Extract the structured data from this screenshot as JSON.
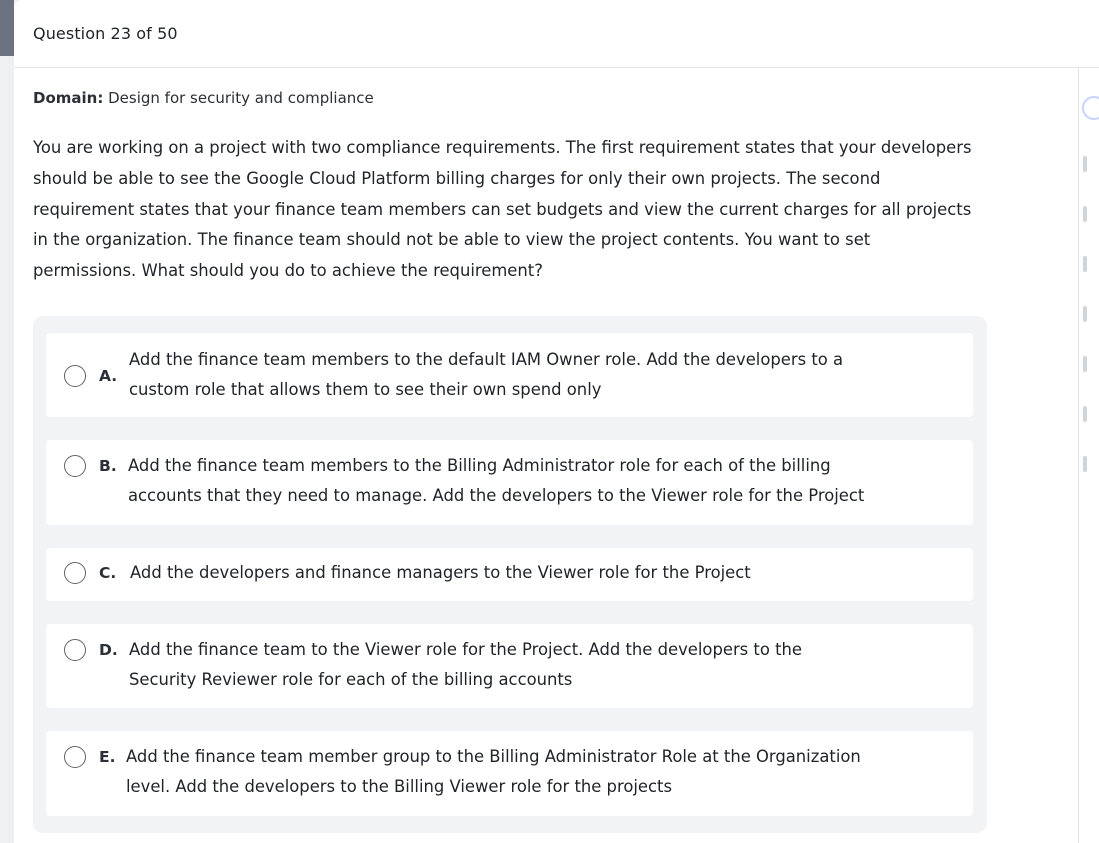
{
  "header": {
    "question_counter": "Question 23 of 50"
  },
  "domain": {
    "label": "Domain:",
    "value": "Design for security and compliance"
  },
  "question": {
    "text": "You are working on a project with two compliance requirements. The first requirement states that your developers should be able to see the Google Cloud Platform billing charges for only their own projects. The second requirement states that your finance team members can set budgets and view the current charges for all projects in the organization. The finance team should not be able to view the project contents. You want to set permissions. What should you do to achieve the requirement?"
  },
  "options": [
    {
      "letter": "A.",
      "text": "Add the finance team members to the default IAM Owner role. Add the developers to a custom role that allows them to see their own spend only"
    },
    {
      "letter": "B.",
      "text": "Add the finance team members to the Billing Administrator role for each of the billing accounts that they need to manage. Add the developers to the Viewer role for the Project"
    },
    {
      "letter": "C.",
      "text": "Add the developers and finance managers to the Viewer role for the Project"
    },
    {
      "letter": "D.",
      "text": "Add the finance team to the Viewer role for the Project. Add the developers to the Security Reviewer role for each of the billing accounts"
    },
    {
      "letter": "E.",
      "text": "Add the finance team member group to the Billing Administrator Role at the Organization level. Add the developers to the Billing Viewer role for the projects"
    }
  ]
}
